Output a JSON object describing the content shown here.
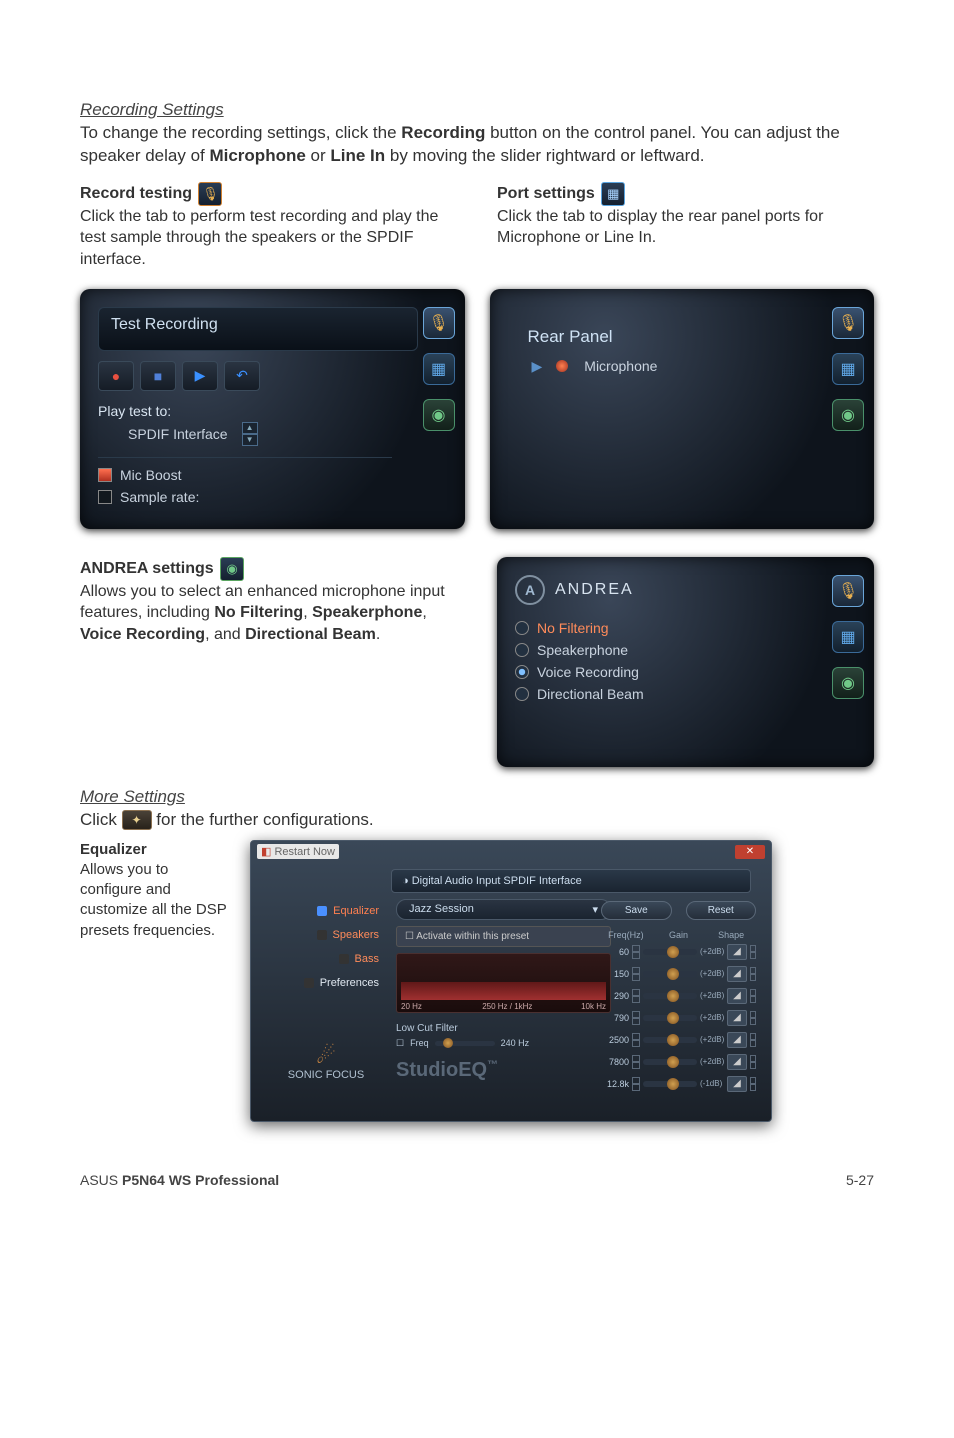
{
  "section1": {
    "title": "Recording Settings",
    "p1_a": "To change the recording settings, click the ",
    "p1_b": "Recording",
    "p1_c": " button on the control panel. You can adjust the speaker delay of ",
    "p1_d": "Microphone",
    "p1_e": " or ",
    "p1_f": "Line In",
    "p1_g": " by moving the slider rightward or leftward."
  },
  "record_testing": {
    "heading": "Record testing",
    "desc": "Click the tab to perform test recording and play the test sample through the speakers or the SPDIF interface."
  },
  "port_settings": {
    "heading": "Port settings",
    "desc": "Click the tab to display the rear panel ports for Microphone or Line In."
  },
  "test_panel": {
    "title": "Test Recording",
    "play_to": "Play test to:",
    "spdif": "SPDIF Interface",
    "mic_boost": "Mic Boost",
    "sample_rate": "Sample rate:"
  },
  "rear_panel": {
    "title": "Rear Panel",
    "mic": "Microphone"
  },
  "andrea": {
    "heading": "ANDREA settings",
    "desc_a": "Allows you to select an enhanced microphone input features, including ",
    "desc_b": "No Filtering",
    "desc_c": ", ",
    "desc_d": "Speakerphone",
    "desc_e": ", ",
    "desc_f": "Voice Recording",
    "desc_g": ", and ",
    "desc_h": "Directional Beam",
    "desc_i": ".",
    "brand": "ANDREA",
    "opt1": "No Filtering",
    "opt2": "Speakerphone",
    "opt3": "Voice Recording",
    "opt4": "Directional Beam"
  },
  "more": {
    "title": "More Settings",
    "click_a": "Click ",
    "click_b": " for the further configurations."
  },
  "equalizer": {
    "heading": "Equalizer",
    "desc": "Allows you to configure and customize all the DSP presets frequencies."
  },
  "eq_window": {
    "title": "Restart Now",
    "header": "Digital Audio Input SPDIF Interface",
    "nav": {
      "eq": "Equalizer",
      "spk": "Speakers",
      "bass": "Bass",
      "pref": "Preferences",
      "brand": "SONIC FOCUS"
    },
    "preset": "Jazz Session",
    "activate": "Activate within this preset",
    "lowcut": "Low Cut Filter",
    "freq_lbl": "Freq",
    "freq_val": "240 Hz",
    "studio": "StudioEQ",
    "tm": "™",
    "save": "Save",
    "reset": "Reset",
    "cols": {
      "f": "Freq(Hz)",
      "g": "Gain",
      "s": "Shape"
    },
    "rows": [
      {
        "f": "60",
        "db": "(+2dB)"
      },
      {
        "f": "150",
        "db": "(+2dB)"
      },
      {
        "f": "290",
        "db": "(+2dB)"
      },
      {
        "f": "790",
        "db": "(+2dB)"
      },
      {
        "f": "2500",
        "db": "(+2dB)"
      },
      {
        "f": "7800",
        "db": "(+2dB)"
      },
      {
        "f": "12.8k",
        "db": "(-1dB)"
      }
    ],
    "graph_left": "20 Hz",
    "graph_mid": "250 Hz / 1kHz",
    "graph_right": "10k Hz"
  },
  "footer": {
    "left_a": "ASUS ",
    "left_b": "P5N64 WS Professional",
    "right": "5-27"
  }
}
